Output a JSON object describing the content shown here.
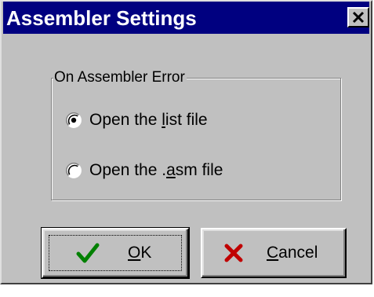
{
  "window": {
    "title": "Assembler Settings",
    "close_glyph": "✕"
  },
  "group": {
    "label": "On Assembler Error",
    "options": [
      {
        "pre": "Open the ",
        "accel": "l",
        "post": "ist file",
        "selected": true
      },
      {
        "pre": "Open the .",
        "accel": "a",
        "post": "sm file",
        "selected": false
      }
    ]
  },
  "buttons": {
    "ok": {
      "accel": "O",
      "rest": "K",
      "icon": "checkmark-icon",
      "icon_color": "#008000"
    },
    "cancel": {
      "accel": "C",
      "rest": "ancel",
      "icon": "x-mark-icon",
      "icon_color": "#c00000"
    }
  }
}
